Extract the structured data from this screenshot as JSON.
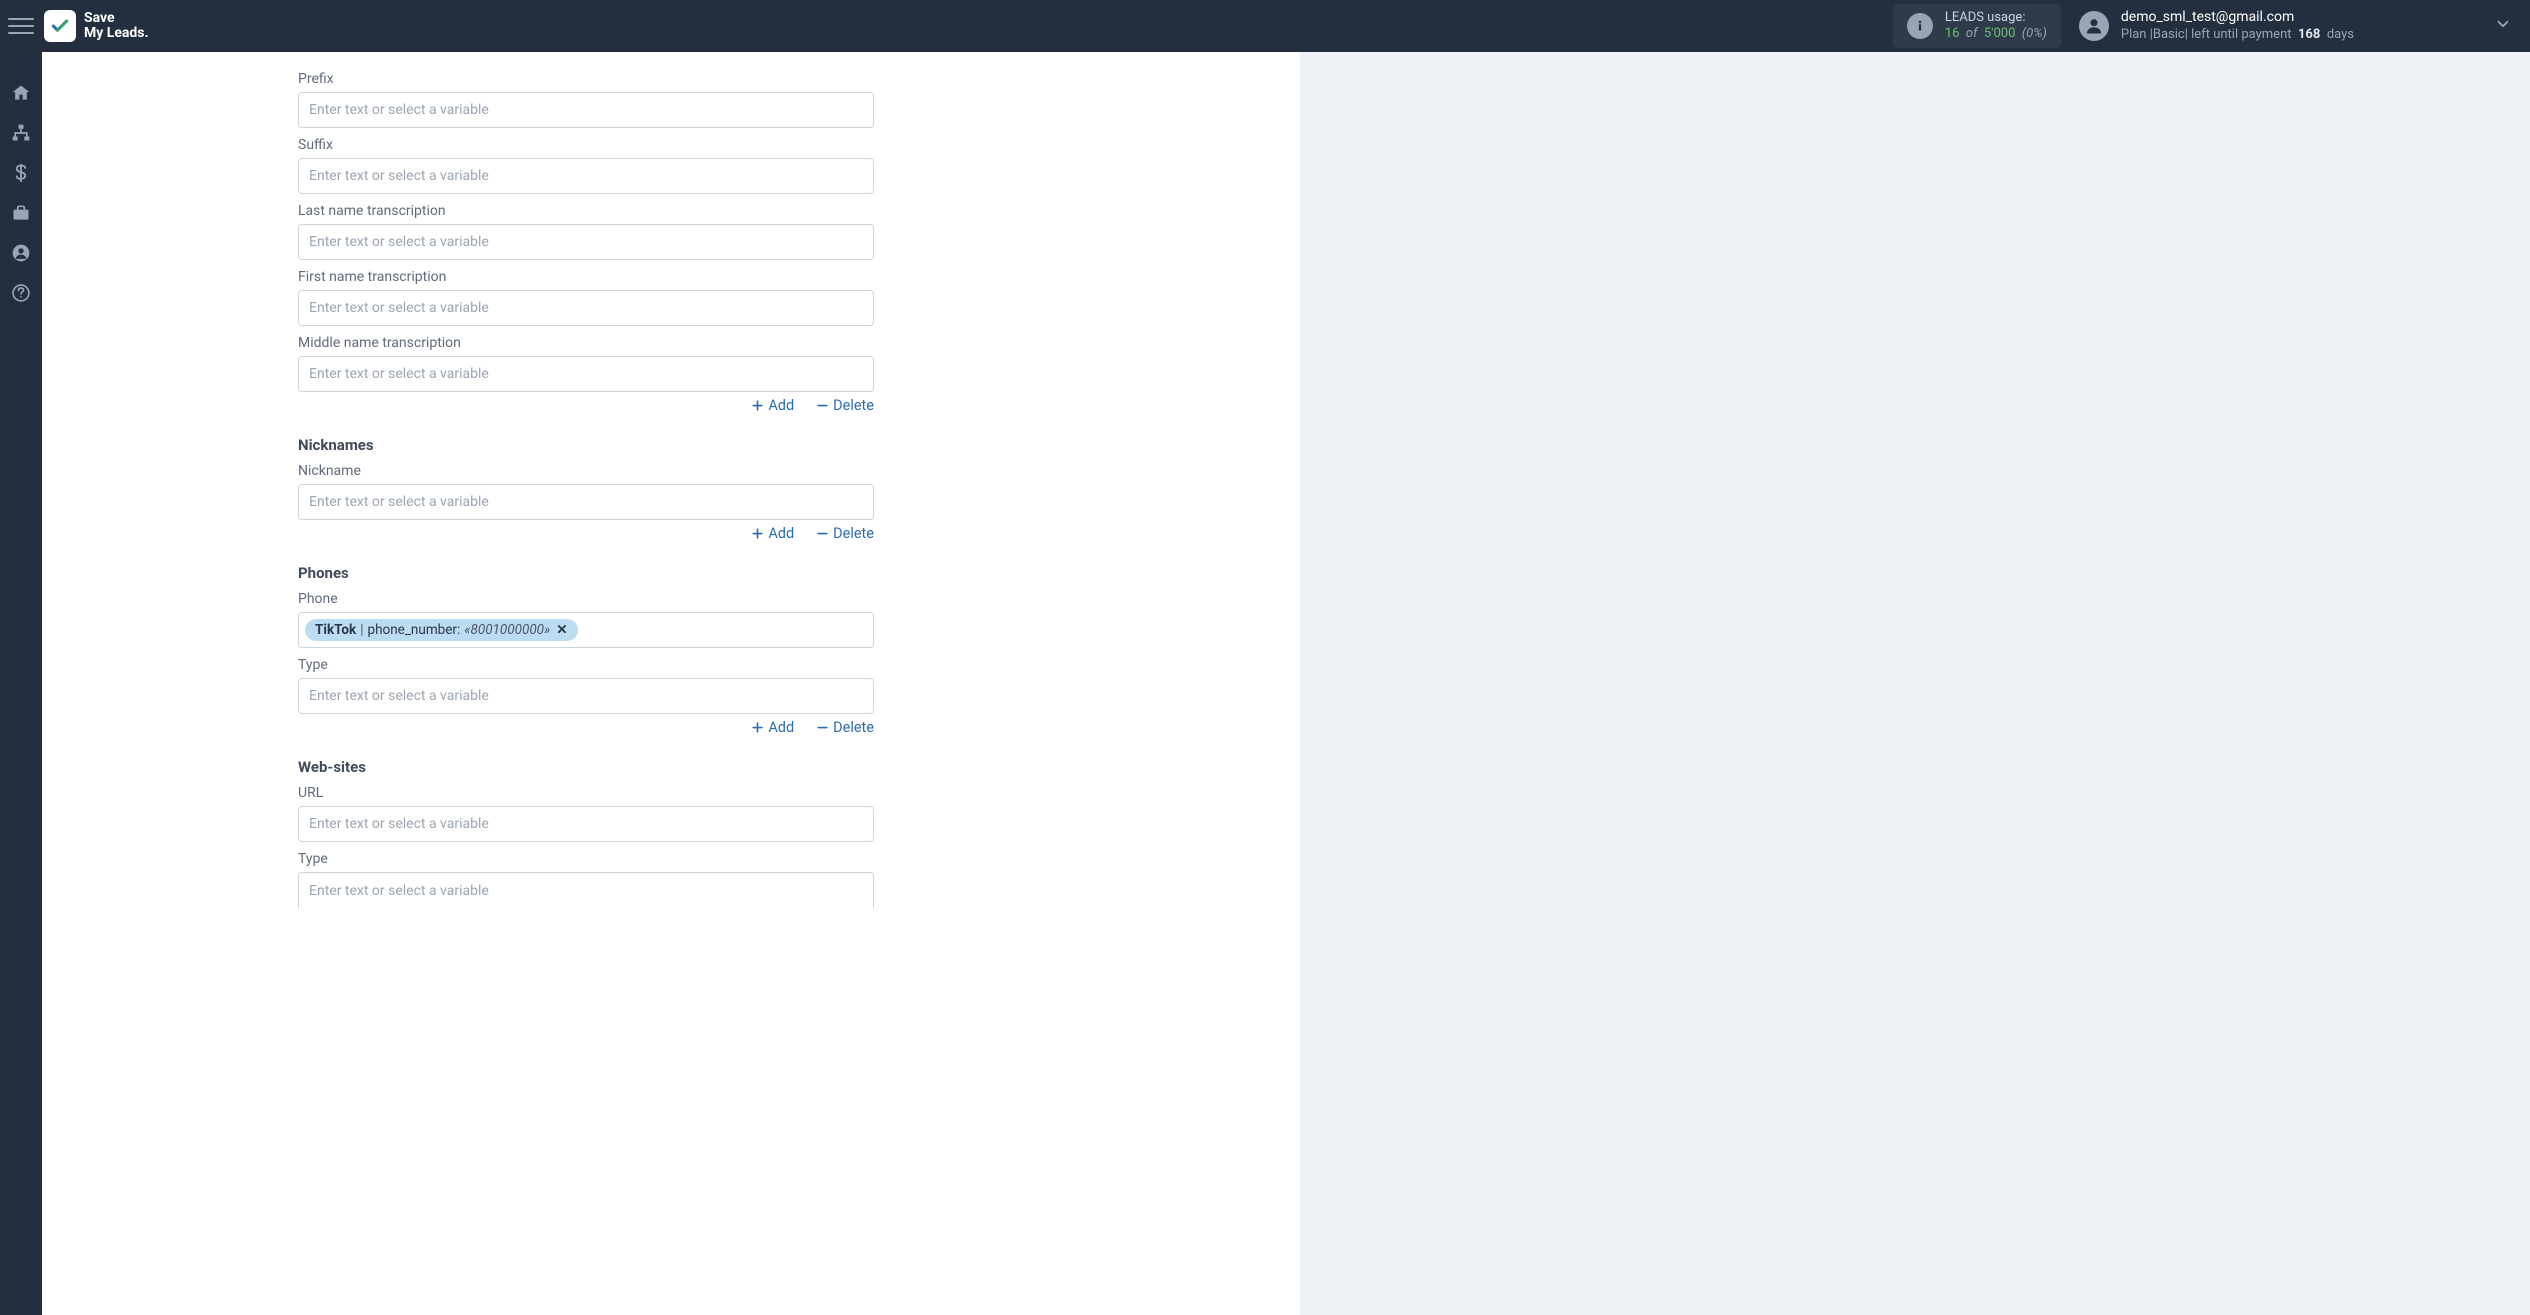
{
  "brand": {
    "line1": "Save",
    "line2": "My Leads."
  },
  "usage": {
    "title": "LEADS usage:",
    "count": "16",
    "of": "of",
    "max": "5'000",
    "pct": "(0%)"
  },
  "user": {
    "email": "demo_sml_test@gmail.com",
    "plan_prefix": "Plan |",
    "plan_name": "Basic",
    "plan_sep": "| left until payment",
    "days_count": "168",
    "days_unit": "days"
  },
  "placeholders": {
    "var": "Enter text or select a variable"
  },
  "labels": {
    "prefix": "Prefix",
    "suffix": "Suffix",
    "last_name_tr": "Last name transcription",
    "first_name_tr": "First name transcription",
    "middle_name_tr": "Middle name transcription",
    "nicknames_head": "Nicknames",
    "nickname": "Nickname",
    "phones_head": "Phones",
    "phone": "Phone",
    "type": "Type",
    "websites_head": "Web-sites",
    "url": "URL",
    "add": "Add",
    "delete": "Delete"
  },
  "phone_chip": {
    "source": "TikTok",
    "field": "phone_number:",
    "value": "«8001000000»"
  }
}
